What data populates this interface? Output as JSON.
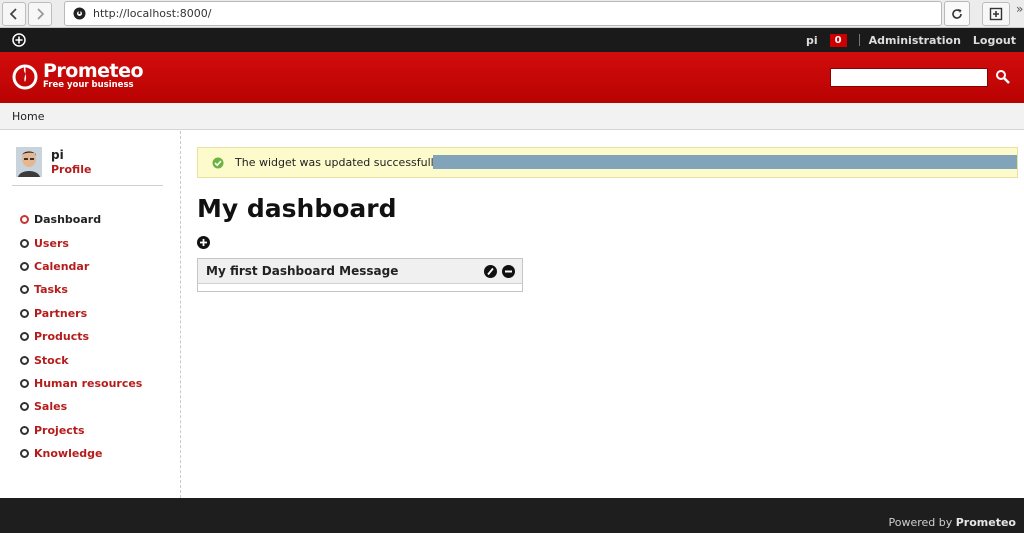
{
  "browser": {
    "url": "http://localhost:8000/",
    "overflow_glyph": "»"
  },
  "topbar": {
    "user": "pi",
    "notification_count": "0",
    "links": [
      "Administration",
      "Logout"
    ]
  },
  "header": {
    "brand_name": "Prometeo",
    "brand_tagline": "Free your business",
    "search_value": ""
  },
  "breadcrumb": {
    "home": "Home"
  },
  "sidebar": {
    "profile": {
      "name": "pi",
      "link": "Profile"
    },
    "menu": [
      {
        "label": "Dashboard",
        "active": true
      },
      {
        "label": "Users"
      },
      {
        "label": "Calendar"
      },
      {
        "label": "Tasks"
      },
      {
        "label": "Partners"
      },
      {
        "label": "Products"
      },
      {
        "label": "Stock"
      },
      {
        "label": "Human resources"
      },
      {
        "label": "Sales"
      },
      {
        "label": "Projects"
      },
      {
        "label": "Knowledge"
      }
    ]
  },
  "main": {
    "notice": "The widget was updated successfully.",
    "title": "My dashboard",
    "widget_title": "My first Dashboard Message"
  },
  "footer": {
    "powered_prefix": "Powered by",
    "powered_brand": "Prometeo"
  },
  "colors": {
    "brand_red": "#c60808",
    "link_red": "#b51c1c",
    "notice_bg": "#fdfbcc"
  },
  "icons": [
    "back-icon",
    "forward-icon",
    "globe-icon",
    "reload-icon",
    "new-tab-icon",
    "plus-circle-icon",
    "search-icon",
    "check-icon",
    "edit-icon",
    "remove-icon",
    "flame-logo-icon"
  ]
}
